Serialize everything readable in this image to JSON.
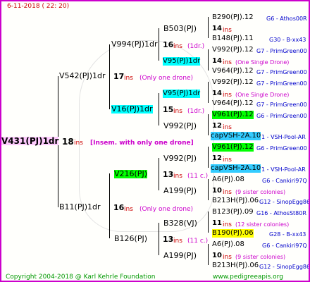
{
  "date": "6-11-2018 ( 22: 20)",
  "root": {
    "name": "V431(PJ)1dr",
    "num": "18",
    "ins": "ins",
    "note": "[Insem. with only one drone]"
  },
  "l1": [
    {
      "name": "V542(PJ)1dr",
      "num": "17",
      "ins": "ins",
      "note": "(Only one drone)"
    },
    {
      "name": "B11(PJ)1dr",
      "num": "16",
      "ins": "ins",
      "note": "(Only one drone)"
    }
  ],
  "l2": [
    {
      "name": "V994(PJ)1dr",
      "num": "16",
      "ins": "ins",
      "note": "(1dr.)"
    },
    {
      "name": "V16(PJ)1dr",
      "num": "15",
      "ins": "ins",
      "note": "(1dr.)"
    },
    {
      "name": "V216(PJ)",
      "num": "13",
      "ins": "ins",
      "note": "(11 c.)"
    },
    {
      "name": "B126(PJ)",
      "num": "13",
      "ins": "ins",
      "note": "(11 c.)"
    }
  ],
  "l3": [
    {
      "name": "B503(PJ)",
      "num": "14",
      "ins": "ins",
      "note": ""
    },
    {
      "name": "V95(PJ)1dr",
      "num": "14",
      "ins": "ins",
      "note": "(1dr.)"
    },
    {
      "name": "V95(PJ)1dr",
      "num": "14",
      "ins": "ins",
      "note": "(1dr.)"
    },
    {
      "name": "V992(PJ)",
      "num": "12",
      "ins": "ins",
      "note": ""
    },
    {
      "name": "V992(PJ)",
      "num": "12",
      "ins": "ins",
      "note": ""
    },
    {
      "name": "A199(PJ)",
      "num": "10",
      "ins": "ins",
      "note": "(9 c.)"
    },
    {
      "name": "B328(VJ)",
      "num": "11",
      "ins": "ins",
      "note": "(12 c.)"
    },
    {
      "name": "A199(PJ)",
      "num": "10",
      "ins": "ins",
      "note": "(9 c.)"
    }
  ],
  "l4": [
    {
      "name": "B290(PJ).12",
      "g": "G6 - Athos00R"
    },
    {
      "num": "14",
      "ins": "ins",
      "note": ""
    },
    {
      "name": "B148(PJ).11",
      "g": "G30 - B-xx43"
    },
    {
      "name": "V992(PJ).12",
      "g": "G7 - PrimGreen00"
    },
    {
      "num": "14",
      "ins": "ins",
      "note": "(One Single Drone)"
    },
    {
      "name": "V964(PJ).12",
      "g": "G7 - PrimGreen00"
    },
    {
      "name": "V992(PJ).12",
      "g": "G7 - PrimGreen00"
    },
    {
      "num": "14",
      "ins": "ins",
      "note": "(One Single Drone)"
    },
    {
      "name": "V964(PJ).12",
      "g": "G7 - PrimGreen00"
    },
    {
      "name": "V961(PJ).12",
      "g": "G6 - PrimGreen00"
    },
    {
      "num": "12",
      "ins": "ins",
      "note": ""
    },
    {
      "name": "capVSH-2A.10",
      "g": "1 - VSH-Pool-AR"
    },
    {
      "name": "V961(PJ).12",
      "g": "G6 - PrimGreen00"
    },
    {
      "num": "12",
      "ins": "ins",
      "note": ""
    },
    {
      "name": "capVSH-2A.10",
      "g": "1 - VSH-Pool-AR"
    },
    {
      "name": "A6(PJ).08",
      "g": "G6 - Cankiri97Q"
    },
    {
      "num": "10",
      "ins": "ins",
      "note": "(9 sister colonies)"
    },
    {
      "name": "B213H(PJ).06",
      "g": "G12 - SinopEgg86R"
    },
    {
      "name": "B123(PJ).09",
      "g": "G16 - AthosSt80R"
    },
    {
      "num": "11",
      "ins": "ins",
      "note": "(12 sister colonies)"
    },
    {
      "name": "B190(PJ).06",
      "g": "G28 - B-xx43"
    },
    {
      "name": "A6(PJ).08",
      "g": "G6 - Cankiri97Q"
    },
    {
      "num": "10",
      "ins": "ins",
      "note": "(9 sister colonies)"
    },
    {
      "name": "B213H(PJ).06",
      "g": "G12 - SinopEgg86R"
    }
  ],
  "footer": {
    "copyright": "Copyright 2004-2018 @ Karl Kehrle Foundation",
    "url": "www.pedigreeapis.org"
  }
}
